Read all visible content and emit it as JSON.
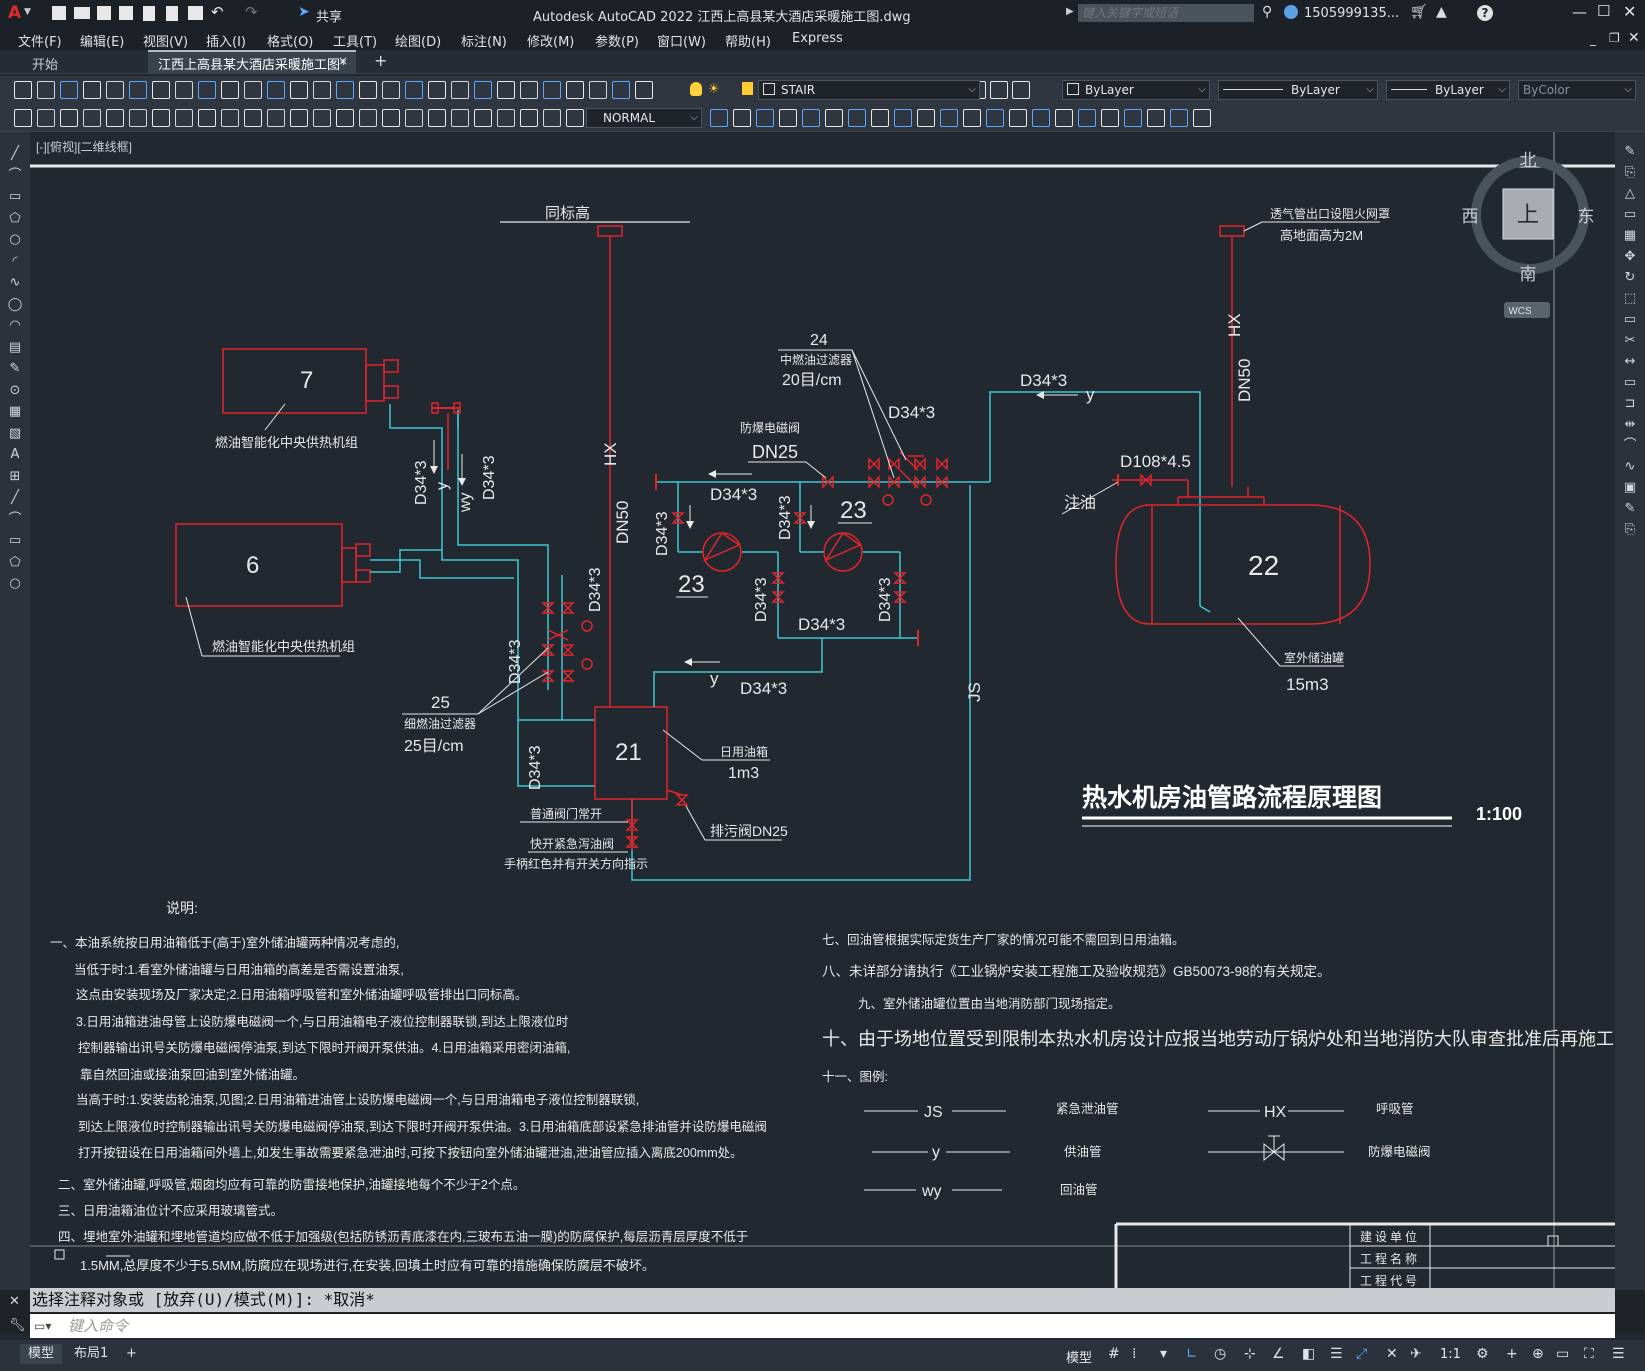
{
  "titlebar": {
    "app_letter": "A",
    "share_label": "共享",
    "title": "Autodesk AutoCAD 2022    江西上高县某大酒店采暖施工图.dwg",
    "search_placeholder": "键入关键字或短语",
    "user": "1505999135...",
    "help": "?"
  },
  "menubar": {
    "items": [
      "文件(F)",
      "编辑(E)",
      "视图(V)",
      "插入(I)",
      "格式(O)",
      "工具(T)",
      "绘图(D)",
      "标注(N)",
      "修改(M)",
      "参数(P)",
      "窗口(W)",
      "帮助(H)",
      "Express"
    ]
  },
  "tabs": {
    "start": "开始",
    "active": "江西上高县某大酒店采暖施工图*",
    "close": "×",
    "add": "+"
  },
  "toolbar": {
    "layer_name": "STAIR",
    "color": "ByLayer",
    "linetype": "ByLayer",
    "lineweight": "ByLayer",
    "plotstyle": "ByColor",
    "textstyle": "NORMAL"
  },
  "viewport": {
    "label": "[-][俯视][二维线框]",
    "viewcube": {
      "north": "北",
      "south": "南",
      "east": "东",
      "west": "西",
      "top": "上",
      "wcs": "WCS"
    }
  },
  "drawing": {
    "title": "热水机房油管路流程原理图",
    "scale": "1:100",
    "equipment": {
      "boiler7_num": "7",
      "boiler6_num": "6",
      "boiler_label": "燃油智能化中央供热机组",
      "tank21_num": "21",
      "tank21_name": "日用油箱",
      "tank21_vol": "1m3",
      "tank22_num": "22",
      "tank22_name": "室外储油罐",
      "tank22_vol": "15m3",
      "pump_num": "23",
      "filter24_num": "24",
      "filter24_name": "中燃油过滤器",
      "filter24_spec": "20目/cm",
      "filter25_num": "25",
      "filter25_name": "细燃油过滤器",
      "filter25_spec": "25目/cm"
    },
    "labels": {
      "same_elev": "同标高",
      "vent_note1": "透气管出口设阻火网罩",
      "vent_note2": "高地面高为2M",
      "hx": "HX",
      "dn50": "DN50",
      "d34": "D34*3",
      "d108": "D108*4.5",
      "fill": "注油",
      "y": "y",
      "wy": "wy",
      "js": "JS",
      "solenoid": "防爆电磁阀",
      "dn25": "DN25",
      "drain": "排污阀DN25",
      "normal_open": "普通阀门常开",
      "quick_valve": "快开紧急泻油阀",
      "handle_note": "手柄红色并有开关方向指示"
    },
    "notes_title": "说明:",
    "notes_left": [
      "一、本油系统按日用油箱低于(高于)室外储油罐两种情况考虑的,",
      "当低于时:1.看室外储油罐与日用油箱的高差是否需设置油泵,",
      "这点由安装现场及厂家决定;2.日用油箱呼吸管和室外储油罐呼吸管排出口同标高。",
      "3.日用油箱进油母管上设防爆电磁阀一个,与日用油箱电子液位控制器联锁,到达上限液位时",
      "控制器输出讯号关防爆电磁阀停油泵,到达下限时开阀开泵供油。4.日用油箱采用密闭油箱,",
      "靠自然回油或接油泵回油到室外储油罐。",
      "当高于时:1.安装齿轮油泵,见图;2.日用油箱进油管上设防爆电磁阀一个,与日用油箱电子液位控制器联锁,",
      "到达上限液位时控制器输出讯号关防爆电磁阀停油泵,到达下限时开阀开泵供油。3.日用油箱底部设紧急排油管并设防爆电磁阀",
      "打开按钮设在日用油箱间外墙上,如发生事故需要紧急泄油时,可按下按钮向室外储油罐泄油,泄油管应插入离底200mm处。",
      "二、室外储油罐,呼吸管,烟囱均应有可靠的防雷接地保护,油罐接地每个不少于2个点。",
      "三、日用油箱油位计不应采用玻璃管式。",
      "四、埋地室外油罐和埋地管道均应做不低于加强级(包括防锈沥青底漆在内,三玻布五油一膜)的防腐保护,每层沥青层厚度不低于",
      "1.5MM,总厚度不少于5.5MM,防腐应在现场进行,在安装,回填土时应有可靠的措施确保防腐层不破坏。"
    ],
    "notes_right": [
      "七、回油管根据实际定货生产厂家的情况可能不需回到日用油箱。",
      "八、未详部分请执行《工业锅炉安装工程施工及验收规范》GB50073-98的有关规定。",
      "九、室外储油罐位置由当地消防部门现场指定。",
      "十、由于场地位置受到限制本热水机房设计应报当地劳动厅锅炉处和当地消防大队审查批准后再施工",
      "十一、图例:"
    ],
    "legend": [
      {
        "code": "JS",
        "name": "紧急泄油管"
      },
      {
        "code": "y",
        "name": "供油管"
      },
      {
        "code": "wy",
        "name": "回油管"
      },
      {
        "code": "HX",
        "name": "呼吸管"
      },
      {
        "code": "",
        "name": "防爆电磁阀"
      }
    ],
    "titleblock": [
      "建设单位",
      "工程名称",
      "工程代号"
    ]
  },
  "command": {
    "history": "选择注释对象或 [放弃(U)/模式(M)]: *取消*",
    "placeholder": "键入命令"
  },
  "status": {
    "model_tab": "模型",
    "layout_tab": "布局1",
    "add": "+",
    "model_label": "模型",
    "scale": "1:1"
  },
  "colors": {
    "background": "#212830",
    "red": "#e0262b",
    "cyan": "#3fc6d4",
    "white": "#e8e8e8"
  }
}
